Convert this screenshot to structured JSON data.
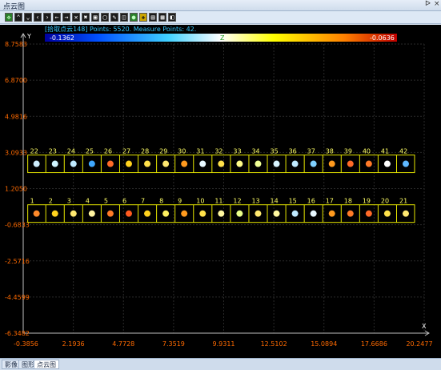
{
  "window": {
    "title": "点云图",
    "pin_glyph": "ᐅ",
    "close_glyph": "×"
  },
  "toolbar": {
    "buttons": [
      {
        "name": "fit-view-button",
        "glyph": "✥",
        "style": "green"
      },
      {
        "name": "arrow-up-button",
        "glyph": "⌃",
        "style": ""
      },
      {
        "name": "arrow-down-button",
        "glyph": "⌄",
        "style": ""
      },
      {
        "name": "arrow-left-button",
        "glyph": "‹",
        "style": ""
      },
      {
        "name": "arrow-right-button",
        "glyph": "›",
        "style": ""
      },
      {
        "name": "move-left-button",
        "glyph": "←",
        "style": ""
      },
      {
        "name": "move-right-button",
        "glyph": "→",
        "style": ""
      },
      {
        "name": "cross-button",
        "glyph": "✕",
        "style": ""
      },
      {
        "name": "cross-filled-button",
        "glyph": "✖",
        "style": ""
      },
      {
        "name": "frame-button",
        "glyph": "▣",
        "style": ""
      },
      {
        "name": "select-box-button",
        "glyph": "▢",
        "style": ""
      },
      {
        "name": "pencil-button",
        "glyph": "✎",
        "style": ""
      },
      {
        "name": "select-zone-button",
        "glyph": "◫",
        "style": ""
      },
      {
        "name": "point-button",
        "glyph": "●",
        "style": "green"
      },
      {
        "name": "zoom-in-button",
        "glyph": "✚",
        "style": "yellow"
      },
      {
        "name": "layers-button",
        "glyph": "▤",
        "style": ""
      },
      {
        "name": "settings-button",
        "glyph": "▦",
        "style": ""
      },
      {
        "name": "save-button",
        "glyph": "◧",
        "style": ""
      }
    ]
  },
  "colors": {
    "tick_label": "#ff6a00",
    "box": "#e6e600",
    "marker_label": "#ffff66",
    "info_text": "#33c8ff",
    "axis": "#bfbfbf",
    "grid": "#2a2a2a"
  },
  "info_line": "[拾取点云148] Points: 5520. Measure Points: 42.",
  "colorbar": {
    "min_label": "-0.1362",
    "mid_label": "Z",
    "max_label": "-0.0636"
  },
  "chart_data": {
    "type": "scatter",
    "xlabel": "X",
    "ylabel": "Y",
    "xlim": [
      -0.3856,
      20.2477
    ],
    "ylim": [
      -6.3482,
      8.7583
    ],
    "x_ticks": [
      "-0.3856",
      "2.1936",
      "4.7728",
      "7.3519",
      "9.9311",
      "12.5102",
      "15.0894",
      "17.6686",
      "20.2477"
    ],
    "y_ticks": [
      "8.7583",
      "6.8700",
      "4.9816",
      "3.0933",
      "1.2050",
      "-0.6833",
      "-2.5716",
      "-4.4599",
      "-6.3482"
    ],
    "grid": true,
    "measure_points": {
      "top_row_y": 2.5,
      "bottom_row_y": -0.1,
      "top_labels": [
        "22",
        "23",
        "24",
        "25",
        "26",
        "27",
        "28",
        "29",
        "30",
        "31",
        "32",
        "33",
        "34",
        "35",
        "36",
        "37",
        "38",
        "39",
        "40",
        "41",
        "42"
      ],
      "bottom_labels": [
        "1",
        "2",
        "3",
        "4",
        "5",
        "6",
        "7",
        "8",
        "9",
        "10",
        "11",
        "12",
        "13",
        "14",
        "15",
        "16",
        "17",
        "18",
        "19",
        "20",
        "21"
      ],
      "top_x": [
        0.3,
        1.25,
        2.2,
        3.15,
        4.1,
        5.05,
        6.0,
        6.95,
        7.9,
        8.85,
        9.8,
        10.75,
        11.7,
        12.65,
        13.6,
        14.55,
        15.5,
        16.45,
        17.4,
        18.35,
        19.3
      ],
      "bottom_x": [
        0.3,
        1.25,
        2.2,
        3.15,
        4.1,
        5.05,
        6.0,
        6.95,
        7.9,
        8.85,
        9.8,
        10.75,
        11.7,
        12.65,
        13.6,
        14.55,
        15.5,
        16.45,
        17.4,
        18.35,
        19.3
      ],
      "top_colors": [
        "#cfefff",
        "#d0f4ff",
        "#bfeaff",
        "#3fa8ff",
        "#ff6a28",
        "#ffd21e",
        "#ffe14a",
        "#ffe870",
        "#ff9a1e",
        "#e8f8ff",
        "#ffe14a",
        "#fffb88",
        "#f0ff96",
        "#d8f4ff",
        "#bfeaff",
        "#7fd0ff",
        "#ff9a1e",
        "#ff6a28",
        "#ff7a28",
        "#ffffff",
        "#5fb8ff"
      ],
      "bottom_colors": [
        "#ff8a2a",
        "#ffd21e",
        "#ffe870",
        "#fff3a0",
        "#ff7a28",
        "#ff5a20",
        "#ffd21e",
        "#fff060",
        "#ff9a1e",
        "#ffe14a",
        "#fff8a0",
        "#eaff8a",
        "#ffe870",
        "#fff8a0",
        "#bfeaff",
        "#e8f8ff",
        "#ff9a1e",
        "#ff7a28",
        "#ff6a28",
        "#ffe14a",
        "#ffe870"
      ]
    }
  },
  "tabs": [
    "影像",
    "图形",
    "点云图"
  ],
  "active_tab": "点云图"
}
